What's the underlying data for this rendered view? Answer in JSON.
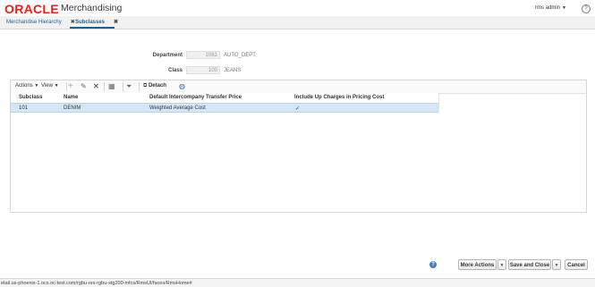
{
  "header": {
    "logo_text": "ORACLE",
    "app_name": "Merchandising",
    "user": "rms admin",
    "brand_color": "#e2231a"
  },
  "tabs": [
    {
      "label": "Merchandise Hierarchy",
      "active": false
    },
    {
      "label": "Subclasses",
      "active": true
    }
  ],
  "form": {
    "department_label": "Department",
    "department_value": "1061",
    "department_desc": "AUTO_DEPT",
    "class_label": "Class",
    "class_value": "100",
    "class_desc": "JEANS"
  },
  "toolbar": {
    "actions_label": "Actions",
    "view_label": "View",
    "detach_label": "Detach"
  },
  "table": {
    "columns": [
      "Subclass",
      "Name",
      "Default Intercompany Transfer Price",
      "Include Up Charges in Pricing Cost"
    ],
    "rows": [
      {
        "subclass": "101",
        "name": "DENIM",
        "transfer_price": "Weighted Average Cost",
        "include_up_charges": "✓"
      }
    ]
  },
  "footer": {
    "more_actions": "More Actions",
    "save_and_close": "Save and Close",
    "cancel": "Cancel"
  },
  "status_bar": {
    "url": "etail.us-phoenix-1.ocs.oc-test.com/rgbu-rex-rgbu-stg200-mfcs/RmsUI/faces/RmsHome#"
  }
}
